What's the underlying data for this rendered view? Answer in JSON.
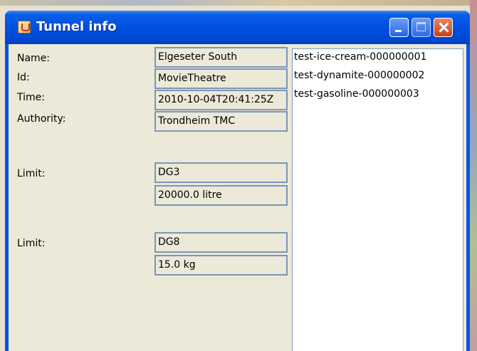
{
  "window": {
    "title": "Tunnel info"
  },
  "fields": {
    "name_label": "Name:",
    "name_value": "Elgeseter South",
    "id_label": "Id:",
    "id_value": "MovieTheatre",
    "time_label": "Time:",
    "time_value": "2010-10-04T20:41:25Z",
    "authority_label": "Authority:",
    "authority_value": "Trondheim TMC"
  },
  "limits": [
    {
      "label": "Limit:",
      "class": "DG3",
      "amount": "20000.0 litre"
    },
    {
      "label": "Limit:",
      "class": "DG8",
      "amount": "15.0 kg"
    }
  ],
  "list": {
    "items": [
      "test-ice-cream-000000001",
      "test-dynamite-000000002",
      "test-gasoline-000000003"
    ]
  },
  "icons": {
    "app": "java-coffee-cup-icon",
    "minimize": "minimize-icon",
    "maximize": "maximize-icon",
    "close": "close-icon"
  }
}
